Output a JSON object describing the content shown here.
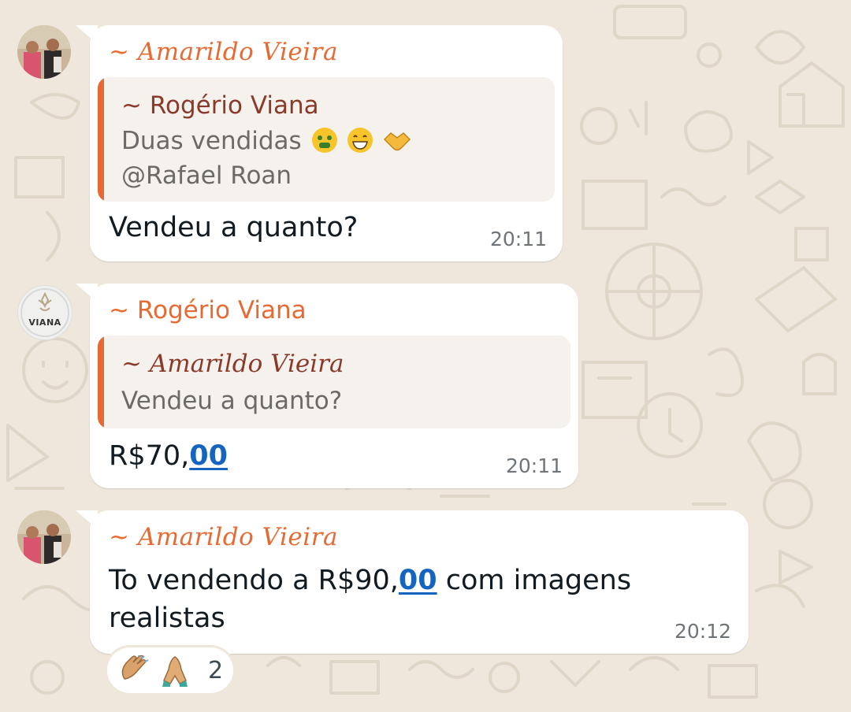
{
  "colors": {
    "background": "#efe7dc",
    "bubble": "#ffffff",
    "accent_orange": "#e86a33",
    "quote_name_brown": "#8b3a2a",
    "link_blue": "#1565c0",
    "time_gray": "#6e7478"
  },
  "messages": [
    {
      "sender": "~ Amarildo Vieira",
      "avatar_icon": "couple-photo-avatar",
      "quote": {
        "sender": "~ Rogério Viana",
        "text_line1": "Duas vendidas",
        "emojis": [
          "money-mouth-face-icon",
          "grinning-face-icon",
          "handshake-icon"
        ],
        "text_line2": "@Rafael Roan"
      },
      "text": "Vendeu a quanto?",
      "time": "20:11"
    },
    {
      "sender": "~ Rogério Viana",
      "avatar_icon": "viana-logo-avatar",
      "avatar_label": "VIANA",
      "quote": {
        "sender": "~ Amarildo Vieira",
        "text": "Vendeu a quanto?"
      },
      "text_prefix": "R$70,",
      "text_link": "00",
      "time": "20:11"
    },
    {
      "sender": "~ Amarildo Vieira",
      "avatar_icon": "couple-photo-avatar",
      "text_prefix": "To vendendo a R$90,",
      "text_link": "00",
      "text_suffix": " com imagens",
      "text_line2": "realistas",
      "time": "20:12",
      "reactions": {
        "emojis": [
          "clapping-hands-icon",
          "folded-hands-icon"
        ],
        "count": "2"
      }
    }
  ]
}
